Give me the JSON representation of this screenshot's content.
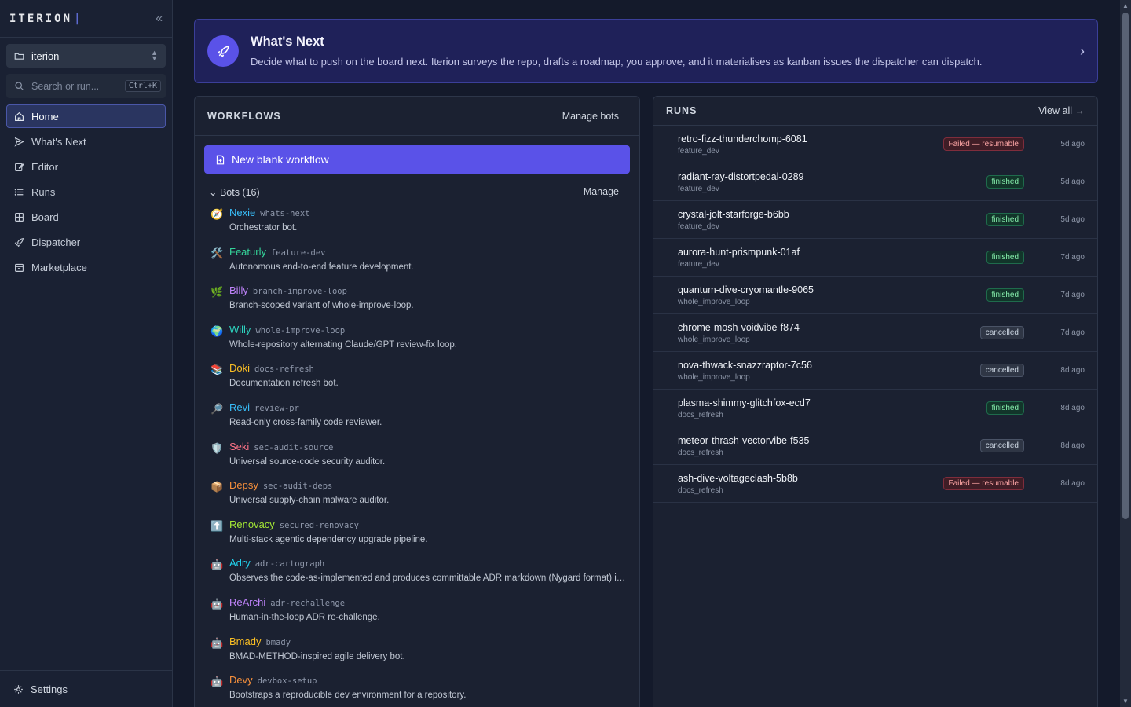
{
  "app": {
    "logo": "ITERION",
    "logo_caret": "|",
    "collapse_glyph": "«",
    "workspace": "iterion",
    "search_placeholder": "Search or run...",
    "search_shortcut": "Ctrl+K",
    "accent": "#5a52e8"
  },
  "nav": [
    {
      "label": "Home",
      "icon": "home-icon",
      "active": true
    },
    {
      "label": "What's Next",
      "icon": "send-icon"
    },
    {
      "label": "Editor",
      "icon": "edit-icon"
    },
    {
      "label": "Runs",
      "icon": "list-icon"
    },
    {
      "label": "Board",
      "icon": "board-icon"
    },
    {
      "label": "Dispatcher",
      "icon": "rocket-icon"
    },
    {
      "label": "Marketplace",
      "icon": "store-icon"
    }
  ],
  "settings_label": "Settings",
  "banner": {
    "title": "What's Next",
    "description": "Decide what to push on the board next. Iterion surveys the repo, drafts a roadmap, you approve, and it materialises as kanban issues the dispatcher can dispatch."
  },
  "workflows": {
    "title": "WORKFLOWS",
    "manage_bots": "Manage bots",
    "new_blank": "New blank workflow",
    "bots_label": "Bots (16)",
    "manage": "Manage",
    "bots": [
      {
        "emoji": "🧭",
        "name": "Nexie",
        "slug": "whats-next",
        "desc": "Orchestrator bot.",
        "color": "#38bdf8"
      },
      {
        "emoji": "🛠️",
        "name": "Featurly",
        "slug": "feature-dev",
        "desc": "Autonomous end-to-end feature development.",
        "color": "#34d399"
      },
      {
        "emoji": "🌿",
        "name": "Billy",
        "slug": "branch-improve-loop",
        "desc": "Branch-scoped variant of whole-improve-loop.",
        "color": "#c084fc"
      },
      {
        "emoji": "🌍",
        "name": "Willy",
        "slug": "whole-improve-loop",
        "desc": "Whole-repository alternating Claude/GPT review-fix loop.",
        "color": "#2dd4bf"
      },
      {
        "emoji": "📚",
        "name": "Doki",
        "slug": "docs-refresh",
        "desc": "Documentation refresh bot.",
        "color": "#fbbf24"
      },
      {
        "emoji": "🔎",
        "name": "Revi",
        "slug": "review-pr",
        "desc": "Read-only cross-family code reviewer.",
        "color": "#38bdf8"
      },
      {
        "emoji": "🛡️",
        "name": "Seki",
        "slug": "sec-audit-source",
        "desc": "Universal source-code security auditor.",
        "color": "#fb7185"
      },
      {
        "emoji": "📦",
        "name": "Depsy",
        "slug": "sec-audit-deps",
        "desc": "Universal supply-chain malware auditor.",
        "color": "#fb923c"
      },
      {
        "emoji": "⬆️",
        "name": "Renovacy",
        "slug": "secured-renovacy",
        "desc": "Multi-stack agentic dependency upgrade pipeline.",
        "color": "#a3e635"
      },
      {
        "emoji": "🤖",
        "name": "Adry",
        "slug": "adr-cartograph",
        "desc": "Observes the code-as-implemented and produces committable ADR markdown (Nygard format) in ...",
        "color": "#22d3ee"
      },
      {
        "emoji": "🤖",
        "name": "ReArchi",
        "slug": "adr-rechallenge",
        "desc": "Human-in-the-loop ADR re-challenge.",
        "color": "#c084fc"
      },
      {
        "emoji": "🤖",
        "name": "Bmady",
        "slug": "bmady",
        "desc": "BMAD-METHOD-inspired agile delivery bot.",
        "color": "#fbbf24"
      },
      {
        "emoji": "🤖",
        "name": "Devy",
        "slug": "devbox-setup",
        "desc": "Bootstraps a reproducible dev environment for a repository.",
        "color": "#fb923c"
      }
    ]
  },
  "runs": {
    "title": "RUNS",
    "view_all": "View all →",
    "items": [
      {
        "name": "retro-fizz-thunderchomp-6081",
        "workflow": "feature_dev",
        "status": "Failed — resumable",
        "kind": "failed",
        "age": "5d ago"
      },
      {
        "name": "radiant-ray-distortpedal-0289",
        "workflow": "feature_dev",
        "status": "finished",
        "kind": "finished",
        "age": "5d ago"
      },
      {
        "name": "crystal-jolt-starforge-b6bb",
        "workflow": "feature_dev",
        "status": "finished",
        "kind": "finished",
        "age": "5d ago"
      },
      {
        "name": "aurora-hunt-prismpunk-01af",
        "workflow": "feature_dev",
        "status": "finished",
        "kind": "finished",
        "age": "7d ago"
      },
      {
        "name": "quantum-dive-cryomantle-9065",
        "workflow": "whole_improve_loop",
        "status": "finished",
        "kind": "finished",
        "age": "7d ago"
      },
      {
        "name": "chrome-mosh-voidvibe-f874",
        "workflow": "whole_improve_loop",
        "status": "cancelled",
        "kind": "cancelled",
        "age": "7d ago"
      },
      {
        "name": "nova-thwack-snazzraptor-7c56",
        "workflow": "whole_improve_loop",
        "status": "cancelled",
        "kind": "cancelled",
        "age": "8d ago"
      },
      {
        "name": "plasma-shimmy-glitchfox-ecd7",
        "workflow": "docs_refresh",
        "status": "finished",
        "kind": "finished",
        "age": "8d ago"
      },
      {
        "name": "meteor-thrash-vectorvibe-f535",
        "workflow": "docs_refresh",
        "status": "cancelled",
        "kind": "cancelled",
        "age": "8d ago"
      },
      {
        "name": "ash-dive-voltageclash-5b8b",
        "workflow": "docs_refresh",
        "status": "Failed — resumable",
        "kind": "failed",
        "age": "8d ago"
      }
    ]
  },
  "status_colors": {
    "failed": {
      "bg": "#3f1d26",
      "border": "#7f2d3c",
      "fg": "#fca5a5"
    },
    "finished": {
      "bg": "#12352a",
      "border": "#1f6b4c",
      "fg": "#86efac"
    },
    "cancelled": {
      "bg": "#2f3645",
      "border": "#4a5366",
      "fg": "#cbd5e1"
    }
  }
}
